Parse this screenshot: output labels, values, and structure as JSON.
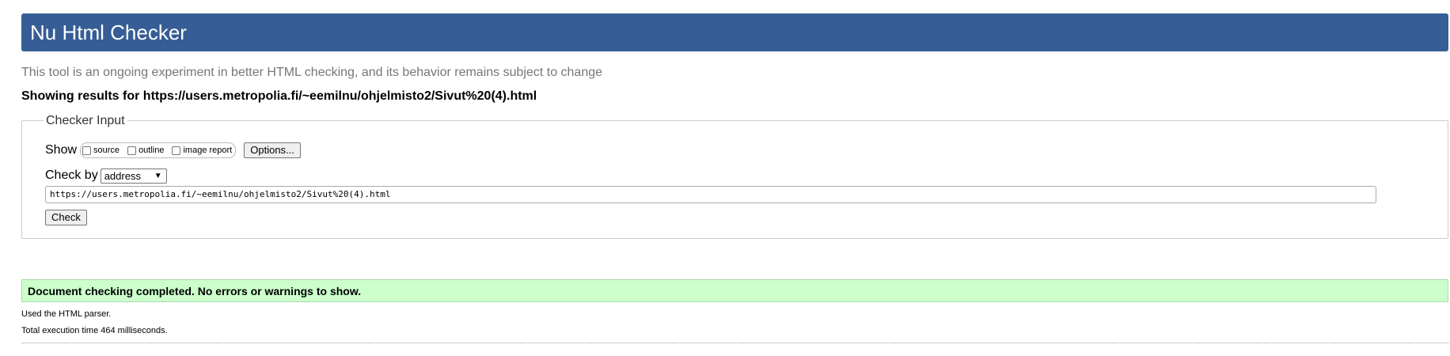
{
  "header": {
    "title": "Nu Html Checker"
  },
  "intro": {
    "text": "This tool is an ongoing experiment in better HTML checking, and its behavior remains subject to change"
  },
  "results": {
    "text": "Showing results for https://users.metropolia.fi/~eemilnu/ohjelmisto2/Sivut%20(4).html"
  },
  "checker_input": {
    "legend": "Checker Input",
    "show_label": "Show",
    "show_options": [
      {
        "label": "source",
        "checked": false
      },
      {
        "label": "outline",
        "checked": false
      },
      {
        "label": "image report",
        "checked": false
      }
    ],
    "options_button": "Options...",
    "check_by_label": "Check by",
    "check_by_selected": "address",
    "url_value": "https://users.metropolia.fi/~eemilnu/ohjelmisto2/Sivut%20(4).html",
    "check_button": "Check"
  },
  "status": {
    "message": "Document checking completed. No errors or warnings to show."
  },
  "info": {
    "parser": "Used the HTML parser.",
    "execution_time": "Total execution time 464 milliseconds."
  },
  "colors": {
    "header_bg": "#365d95",
    "success_bg": "#ccffcc",
    "intro_text": "#777777"
  }
}
